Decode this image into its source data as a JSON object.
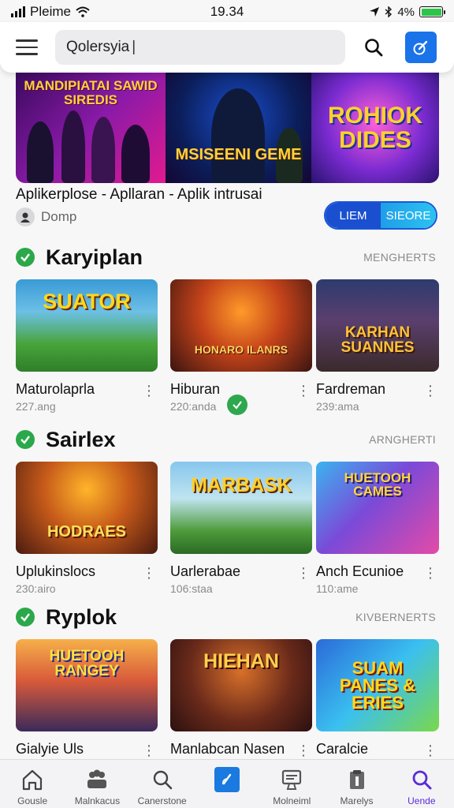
{
  "status_bar": {
    "carrier": "Pleime",
    "time": "19.34",
    "battery": "4%"
  },
  "search": {
    "value": "Qolersyia",
    "placeholder": ""
  },
  "featured": {
    "panels": [
      "MANDIPIATAI SAWID SIREDIS",
      "MSISEENI GEME",
      "ROHIOK DIDES"
    ],
    "title": "Aplikerplose - Apllaran - Aplik intrusai",
    "developer": "Domp",
    "view_label": "LIEM",
    "store_label": "SIEORE"
  },
  "sections": [
    {
      "title": "Karyiplan",
      "more": "MENGHERTS",
      "apps": [
        {
          "name": "Maturolaprla",
          "meta": "227.ang",
          "art": "SUATOR"
        },
        {
          "name": "Hiburan",
          "meta": "220:anda",
          "art": "HONARO ILANRS"
        },
        {
          "name": "Fardreman",
          "meta": "239:ama",
          "art": "KARHAN SUANNES"
        }
      ]
    },
    {
      "title": "Sairlex",
      "more": "ARNGHERTI",
      "apps": [
        {
          "name": "Uplukinslocs",
          "meta": "230:airo",
          "art": "HODRAES"
        },
        {
          "name": "Uarlerabae",
          "meta": "106:staa",
          "art": "MARBASK"
        },
        {
          "name": "Anch Ecunioe",
          "meta": "110:ame",
          "art": "HUETOOH CAMES"
        }
      ]
    },
    {
      "title": "Ryplok",
      "more": "KIVBERNERTS",
      "apps": [
        {
          "name": "Gialyie Uls",
          "meta": "",
          "art": "HUETOOH RANGEY"
        },
        {
          "name": "Manlabcan Nasen",
          "meta": "",
          "art": "HIEHAN"
        },
        {
          "name": "Caralcie",
          "meta": "",
          "art": "SUAM PANES & ERIES"
        }
      ]
    }
  ],
  "bottom_nav": [
    {
      "label": "Gousle",
      "icon": "home-icon"
    },
    {
      "label": "Malnkacus",
      "icon": "people-icon"
    },
    {
      "label": "Canerstone",
      "icon": "search-icon"
    },
    {
      "label": "",
      "icon": "edit-icon"
    },
    {
      "label": "Molneiml",
      "icon": "monitor-icon"
    },
    {
      "label": "Marelys",
      "icon": "clipboard-icon"
    },
    {
      "label": "Uende",
      "icon": "search-icon"
    }
  ],
  "colors": {
    "accent": "#1a73e8",
    "check": "#2ba84a",
    "active_nav": "#5b2bd8"
  }
}
